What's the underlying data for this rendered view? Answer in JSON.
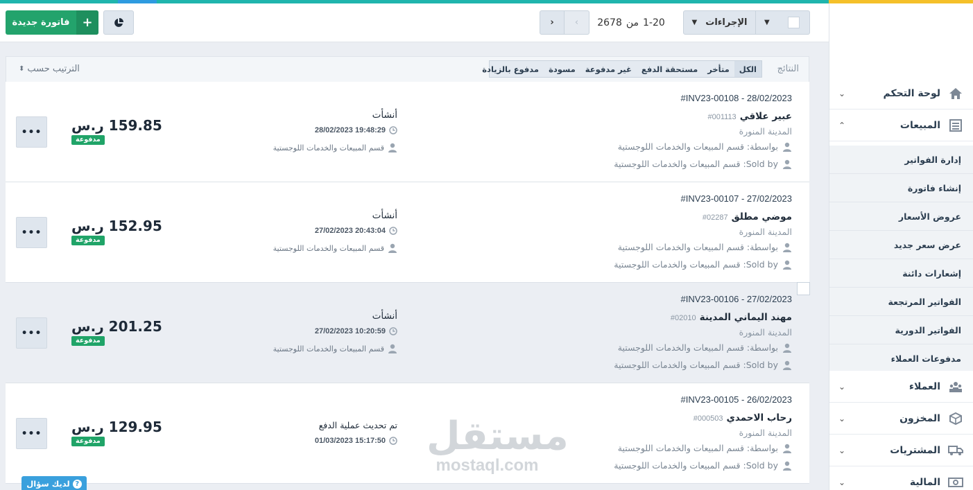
{
  "toolbar": {
    "new_invoice_label": "فاتورة جديدة",
    "actions_label": "الإجراءات",
    "pager_range": "1-20",
    "pager_of": "من",
    "pager_total": "2678"
  },
  "filters": {
    "results_label": "النتائج",
    "tabs": [
      "الكل",
      "متأخر",
      "مستحقة الدفع",
      "غير مدفوعة",
      "مسودة",
      "مدفوع بالزيادة"
    ],
    "active_tab": "الكل",
    "sort_label": "الترتيب حسب"
  },
  "invoices": [
    {
      "title": "#INV23-00108 - 28/02/2023",
      "client": "عبير علاقي",
      "client_no": "#001113",
      "city": "المدينة المنورة",
      "by": "بواسطة: قسم المبيعات والخدمات اللوجستية",
      "sold_by": "Sold by: قسم المبيعات والخدمات اللوجستية",
      "action": "أنشأت",
      "time": "19:48:29 28/02/2023",
      "dept": "قسم المبيعات والخدمات اللوجستية",
      "amount": "159.85 ر.س",
      "status": "مدفوعة"
    },
    {
      "title": "#INV23-00107 - 27/02/2023",
      "client": "موضي مطلق",
      "client_no": "#02287",
      "city": "المدينة المنورة",
      "by": "بواسطة: قسم المبيعات والخدمات اللوجستية",
      "sold_by": "Sold by: قسم المبيعات والخدمات اللوجستية",
      "action": "أنشأت",
      "time": "20:43:04 27/02/2023",
      "dept": "قسم المبيعات والخدمات اللوجستية",
      "amount": "152.95 ر.س",
      "status": "مدفوعة"
    },
    {
      "title": "#INV23-00106 - 27/02/2023",
      "client": "مهند اليماني المدينة",
      "client_no": "#02010",
      "city": "المدينة المنورة",
      "by": "بواسطة: قسم المبيعات والخدمات اللوجستية",
      "sold_by": "Sold by: قسم المبيعات والخدمات اللوجستية",
      "action": "أنشأت",
      "time": "10:20:59 27/02/2023",
      "dept": "قسم المبيعات والخدمات اللوجستية",
      "amount": "201.25 ر.س",
      "status": "مدفوعة"
    },
    {
      "title": "#INV23-00105 - 26/02/2023",
      "client": "رحاب الاحمدي",
      "client_no": "#000503",
      "city": "المدينة المنورة",
      "by": "بواسطة: قسم المبيعات والخدمات اللوجستية",
      "sold_by": "Sold by: قسم المبيعات والخدمات اللوجستية",
      "action": "تم تحديث عملية الدفع",
      "time": "15:17:50 01/03/2023",
      "dept": "",
      "amount": "129.95 ر.س",
      "status": "مدفوعة"
    }
  ],
  "sidebar": {
    "items": [
      {
        "label": "لوحة التحكم",
        "icon": "home-icon"
      },
      {
        "label": "المبيعات",
        "icon": "list-icon"
      },
      {
        "label": "العملاء",
        "icon": "users-icon"
      },
      {
        "label": "المخزون",
        "icon": "box-icon"
      },
      {
        "label": "المشتريات",
        "icon": "truck-icon"
      },
      {
        "label": "المالية",
        "icon": "money-icon"
      }
    ],
    "sales_sub": [
      "إدارة الفواتير",
      "إنشاء فاتورة",
      "عروض الأسعار",
      "عرض سعر جديد",
      "إشعارات دائنة",
      "الفواتير المرتجعة",
      "الفواتير الدورية",
      "مدفوعات العملاء"
    ]
  },
  "watermark": {
    "arabic": "مستقل",
    "latin": "mostaql.com"
  },
  "help_label": "لديك سؤال",
  "colors": {
    "primary_green": "#23a36c",
    "paid_badge": "#20a468",
    "accent_teal": "#1fb5ad",
    "accent_yellow": "#f5c02a"
  }
}
